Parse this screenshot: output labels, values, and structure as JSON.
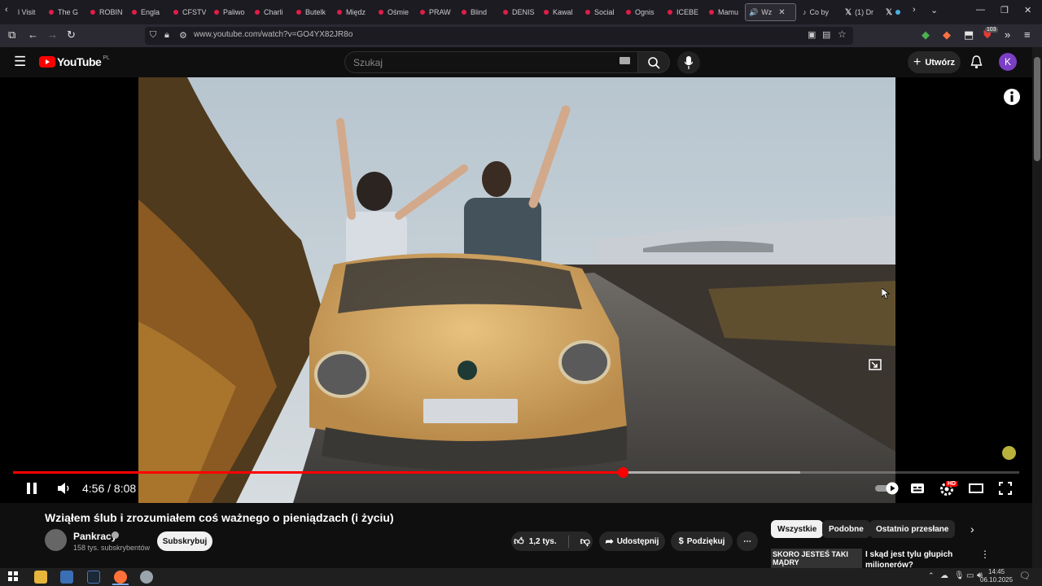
{
  "browser": {
    "tabs": [
      {
        "label": "l Visit"
      },
      {
        "label": "The G"
      },
      {
        "label": "ROBIN"
      },
      {
        "label": "Engla"
      },
      {
        "label": "CFSTV"
      },
      {
        "label": "Paliwo"
      },
      {
        "label": "Charli"
      },
      {
        "label": "Butelk"
      },
      {
        "label": "Międz"
      },
      {
        "label": "Ośmie"
      },
      {
        "label": "PRAW"
      },
      {
        "label": "Blind"
      },
      {
        "label": "DENIS"
      },
      {
        "label": "Kawal"
      },
      {
        "label": "Social"
      },
      {
        "label": "Ognis"
      },
      {
        "label": "ICEBE"
      },
      {
        "label": "Mamu"
      },
      {
        "label": "Wz"
      },
      {
        "label": "Co by"
      },
      {
        "label": "(1) Dr"
      }
    ],
    "url": "www.youtube.com/watch?v=GO4YX82JR8o",
    "badge_count": "103"
  },
  "youtube": {
    "logo_text": "YouTube",
    "region": "PL",
    "search_placeholder": "Szukaj",
    "create_label": "Utwórz",
    "avatar_letter": "K"
  },
  "player": {
    "time_current": "4:56",
    "time_total": "8:08",
    "time_display": "4:56 / 8:08",
    "progress": 0.6066,
    "buffered": 0.782,
    "hd_badge": "HD"
  },
  "video_info": {
    "title": "Wziąłem ślub i zrozumiałem coś ważnego o pieniądzach (i życiu)",
    "channel": "Pankracy",
    "subscribers": "158 tys. subskrybentów",
    "subscribe_label": "Subskrybuj",
    "likes": "1,2 tys.",
    "share_label": "Udostępnij",
    "thanks_label": "Podziękuj"
  },
  "sidebar": {
    "chips": [
      {
        "label": "Wszystkie"
      },
      {
        "label": "Podobne"
      },
      {
        "label": "Ostatnio przesłane"
      }
    ],
    "recommended": {
      "thumb_text": "SKORO JESTEŚ TAKI MĄDRY",
      "title": "I skąd jest tylu głupich milionerów?"
    }
  },
  "taskbar": {
    "time": "14:45",
    "date": "06.10.2025"
  },
  "colors": {
    "accent": "#ff0000",
    "background": "#0f0f0f"
  }
}
